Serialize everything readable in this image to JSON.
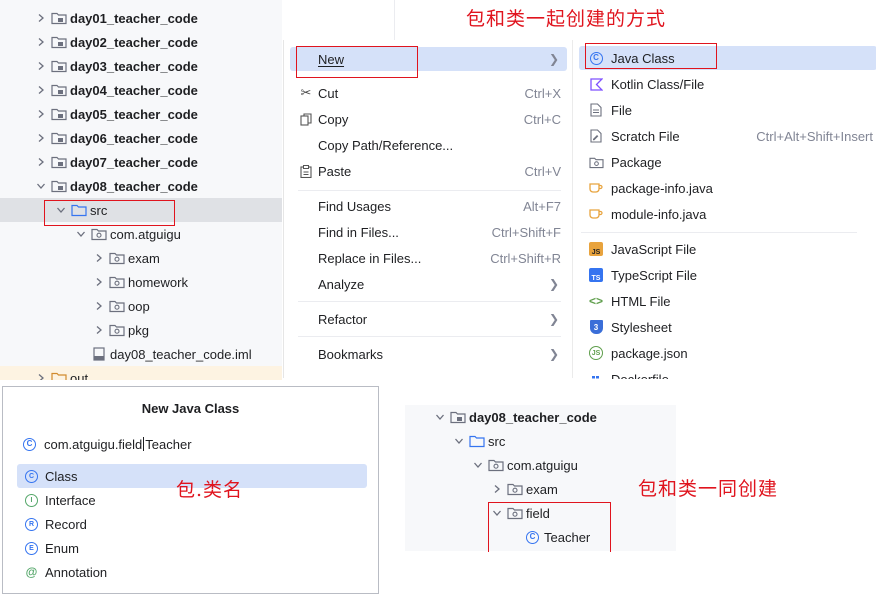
{
  "annotations": {
    "top": "包和类一起创建的方式",
    "dialog": "包.类名",
    "result": "包和类一同创建"
  },
  "tree": {
    "rows": [
      {
        "label": "day01_teacher_code",
        "bold": true,
        "expanded": false
      },
      {
        "label": "day02_teacher_code",
        "bold": true,
        "expanded": false
      },
      {
        "label": "day03_teacher_code",
        "bold": true,
        "expanded": false
      },
      {
        "label": "day04_teacher_code",
        "bold": true,
        "expanded": false
      },
      {
        "label": "day05_teacher_code",
        "bold": true,
        "expanded": false
      },
      {
        "label": "day06_teacher_code",
        "bold": true,
        "expanded": false
      },
      {
        "label": "day07_teacher_code",
        "bold": true,
        "expanded": false
      },
      {
        "label": "day08_teacher_code",
        "bold": true,
        "expanded": true
      },
      {
        "label": "src",
        "bold": false,
        "expanded": true,
        "selected": true
      },
      {
        "label": "com.atguigu",
        "bold": false,
        "expanded": true
      },
      {
        "label": "exam",
        "bold": false,
        "expanded": false
      },
      {
        "label": "homework",
        "bold": false,
        "expanded": false
      },
      {
        "label": "oop",
        "bold": false,
        "expanded": false
      },
      {
        "label": "pkg",
        "bold": false,
        "expanded": false
      },
      {
        "label": "day08_teacher_code.iml",
        "bold": false,
        "expanded": null
      },
      {
        "label": "out",
        "bold": false,
        "expanded": false
      }
    ]
  },
  "context_menu": {
    "items": [
      {
        "label": "New",
        "shortcut": "",
        "submenu": true,
        "icon": "none",
        "highlighted": true
      },
      {
        "label": "Cut",
        "shortcut": "Ctrl+X",
        "submenu": false,
        "icon": "scissors-icon"
      },
      {
        "label": "Copy",
        "shortcut": "Ctrl+C",
        "submenu": false,
        "icon": "copy-icon"
      },
      {
        "label": "Copy Path/Reference...",
        "shortcut": "",
        "submenu": false,
        "icon": "none"
      },
      {
        "label": "Paste",
        "shortcut": "Ctrl+V",
        "submenu": false,
        "icon": "paste-icon"
      },
      {
        "label": "Find Usages",
        "shortcut": "Alt+F7",
        "submenu": false,
        "icon": "none"
      },
      {
        "label": "Find in Files...",
        "shortcut": "Ctrl+Shift+F",
        "submenu": false,
        "icon": "none"
      },
      {
        "label": "Replace in Files...",
        "shortcut": "Ctrl+Shift+R",
        "submenu": false,
        "icon": "none"
      },
      {
        "label": "Analyze",
        "shortcut": "",
        "submenu": true,
        "icon": "none"
      },
      {
        "label": "Refactor",
        "shortcut": "",
        "submenu": true,
        "icon": "none"
      },
      {
        "label": "Bookmarks",
        "shortcut": "",
        "submenu": true,
        "icon": "none"
      }
    ]
  },
  "new_submenu": {
    "items": [
      {
        "label": "Java Class",
        "shortcut": "",
        "icon": "java-class-icon",
        "highlighted": true
      },
      {
        "label": "Kotlin Class/File",
        "shortcut": "",
        "icon": "kotlin-icon"
      },
      {
        "label": "File",
        "shortcut": "",
        "icon": "file-icon"
      },
      {
        "label": "Scratch File",
        "shortcut": "Ctrl+Alt+Shift+Insert",
        "icon": "scratch-file-icon"
      },
      {
        "label": "Package",
        "shortcut": "",
        "icon": "package-icon"
      },
      {
        "label": "package-info.java",
        "shortcut": "",
        "icon": "java-cup-icon"
      },
      {
        "label": "module-info.java",
        "shortcut": "",
        "icon": "java-cup-icon"
      },
      {
        "label": "JavaScript File",
        "shortcut": "",
        "icon": "javascript-icon"
      },
      {
        "label": "TypeScript File",
        "shortcut": "",
        "icon": "typescript-icon"
      },
      {
        "label": "HTML File",
        "shortcut": "",
        "icon": "html-icon"
      },
      {
        "label": "Stylesheet",
        "shortcut": "",
        "icon": "css-icon"
      },
      {
        "label": "package.json",
        "shortcut": "",
        "icon": "nodejs-icon"
      },
      {
        "label": "Dockerfile",
        "shortcut": "",
        "icon": "docker-icon"
      }
    ]
  },
  "dialog": {
    "title": "New Java Class",
    "input_before_cursor": "com.atguigu.field",
    "input_after_cursor": "Teacher",
    "kinds": [
      {
        "label": "Class",
        "glyph": "C",
        "highlighted": true
      },
      {
        "label": "Interface",
        "glyph": "I"
      },
      {
        "label": "Record",
        "glyph": "R"
      },
      {
        "label": "Enum",
        "glyph": "E"
      },
      {
        "label": "Annotation",
        "glyph": "@"
      }
    ]
  },
  "result_tree": {
    "rows": [
      {
        "label": "day08_teacher_code",
        "bold": true
      },
      {
        "label": "src",
        "bold": false
      },
      {
        "label": "com.atguigu",
        "bold": false
      },
      {
        "label": "exam",
        "bold": false
      },
      {
        "label": "field",
        "bold": false
      },
      {
        "label": "Teacher",
        "bold": false
      }
    ]
  },
  "colors": {
    "accent": "#3574f0",
    "highlight": "#d5e1f9",
    "annotation_red": "#e0141e",
    "tree_bg": "#f7f8fa",
    "selected_row": "#dfe1e5"
  }
}
